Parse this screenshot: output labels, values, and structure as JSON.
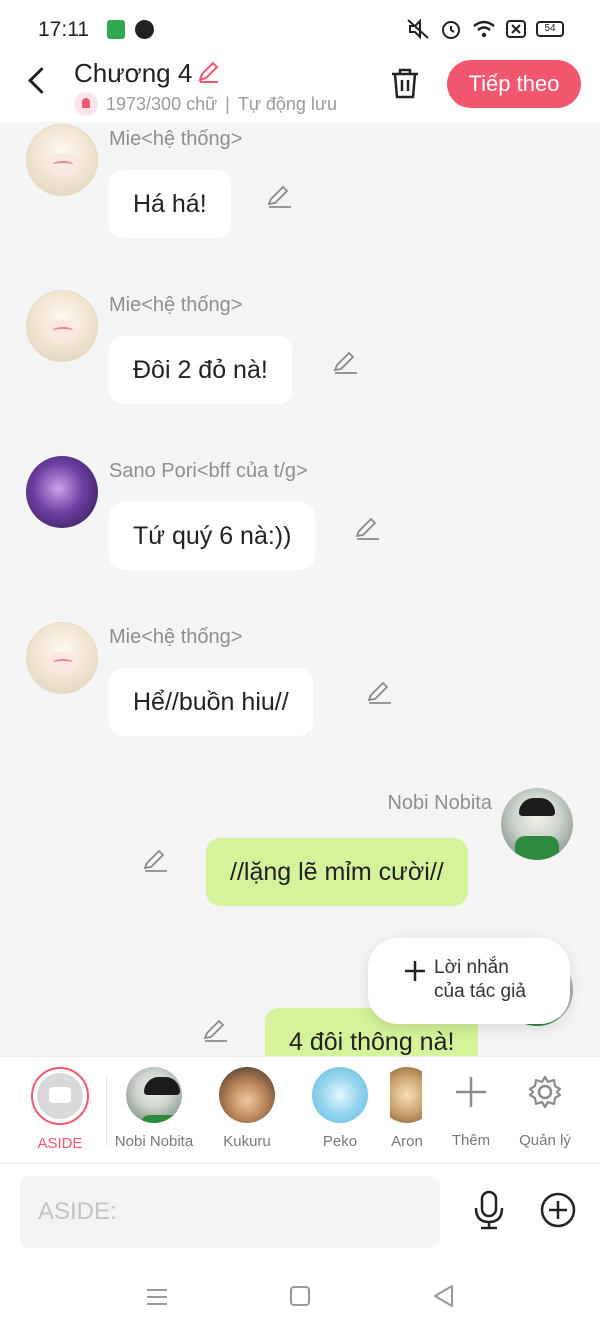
{
  "status_bar": {
    "time": "17:11",
    "battery": "54"
  },
  "header": {
    "title": "Chương 4",
    "word_count": "1973/300 chữ",
    "separator": "|",
    "autosave": "Tự động lưu",
    "next_label": "Tiếp theo"
  },
  "messages": [
    {
      "sender": "Mie<hệ thống>",
      "text": "Há há!",
      "side": "left"
    },
    {
      "sender": "Mie<hệ thống>",
      "text": "Đôi 2 đỏ nà!",
      "side": "left"
    },
    {
      "sender": "Sano Pori<bff của t/g>",
      "text": "Tứ quý 6 nà:))",
      "side": "left"
    },
    {
      "sender": "Mie<hệ thống>",
      "text": "Hể//buồn hiu//",
      "side": "left"
    },
    {
      "sender": "Nobi Nobita",
      "text": "//lặng lẽ mỉm cười//",
      "side": "right"
    },
    {
      "sender": "",
      "text": "4 đôi thông nà!",
      "side": "right"
    }
  ],
  "floating_note": {
    "label_line1": "Lời nhắn",
    "label_line2": "của tác giả"
  },
  "characters": [
    {
      "name": "ASIDE",
      "selected": true
    },
    {
      "name": "Nobi Nobita"
    },
    {
      "name": "Kukuru"
    },
    {
      "name": "Peko"
    },
    {
      "name": "Aron"
    }
  ],
  "tools": {
    "add_label": "Thêm",
    "manage_label": "Quản lý"
  },
  "input": {
    "placeholder": "ASIDE:"
  },
  "colors": {
    "accent": "#f2576f",
    "bubble_green": "#d4f39a",
    "chat_bg": "#f5f5f5"
  }
}
